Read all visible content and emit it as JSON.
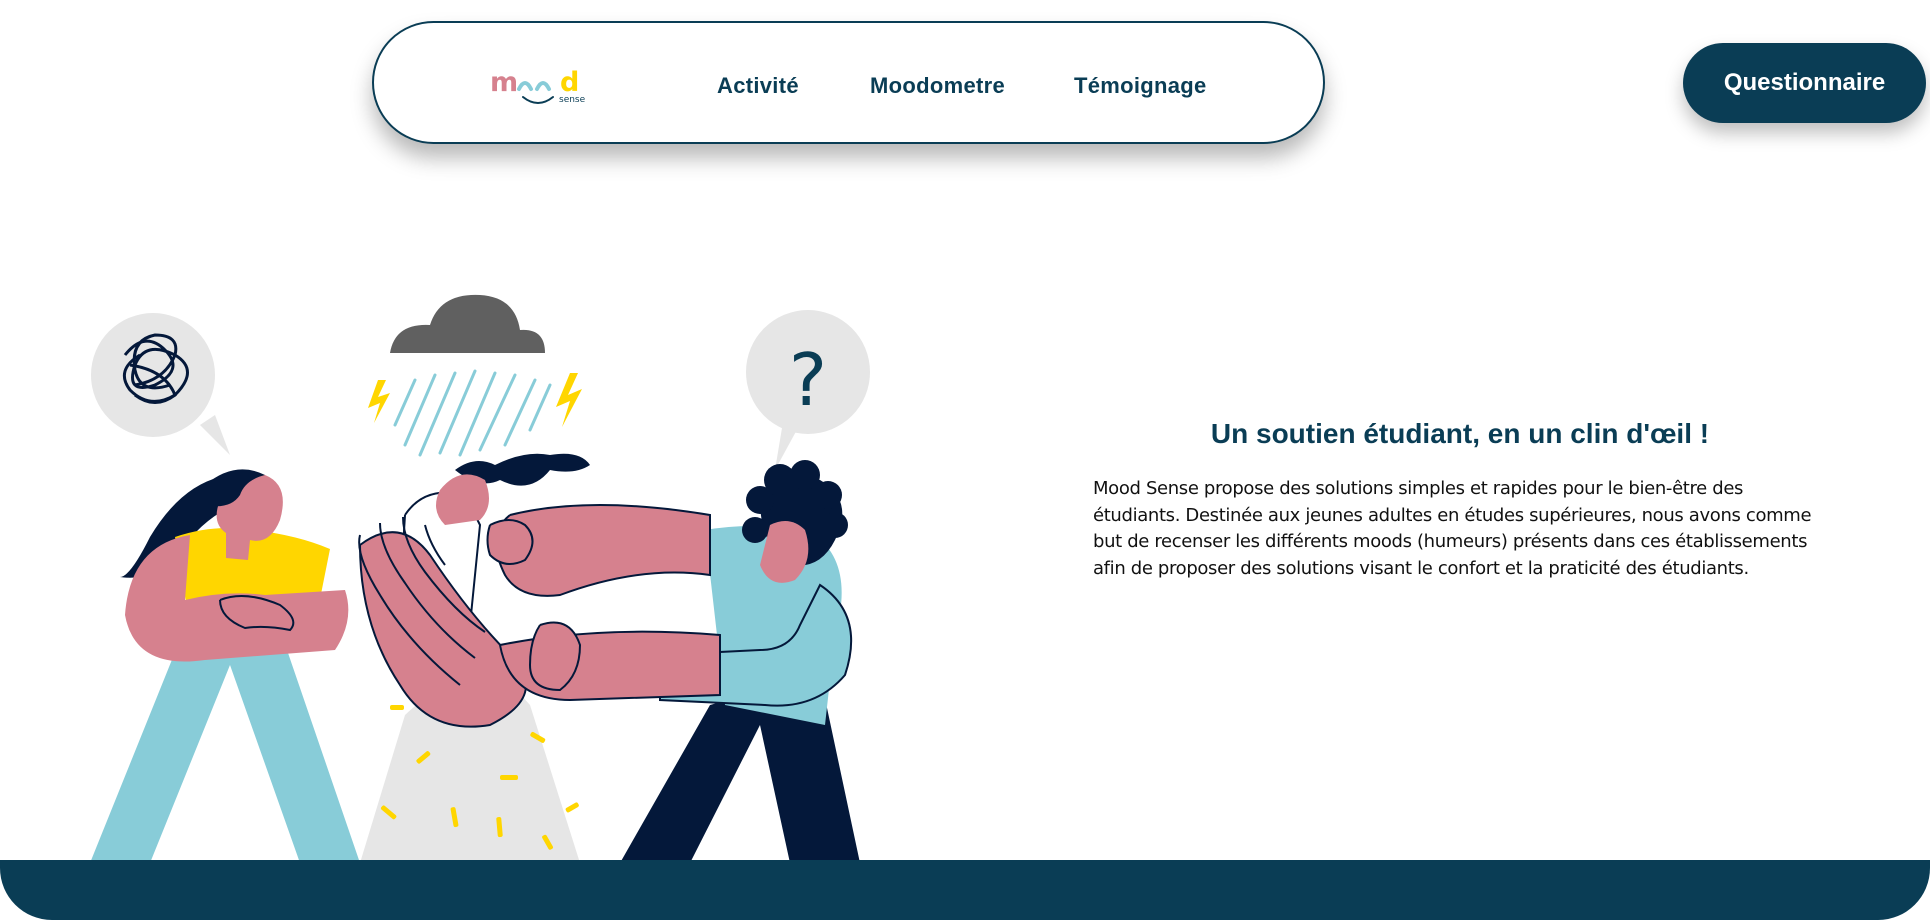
{
  "colors": {
    "primary": "#0a3d55",
    "pink": "#d6818e",
    "yellow": "#ffd600",
    "light_blue": "#88ccd8",
    "navy": "#04183a",
    "grey": "#e6e6e6"
  },
  "logo": {
    "letters_m": "m",
    "letters_d": "d",
    "tagline": "sense"
  },
  "nav": {
    "items": [
      {
        "label": "Activité"
      },
      {
        "label": "Moodometre"
      },
      {
        "label": "Témoignage"
      }
    ]
  },
  "cta": {
    "label": "Questionnaire"
  },
  "hero": {
    "title": "Un soutien étudiant, en un clin d'œil !",
    "body": "Mood Sense propose des solutions simples et rapides pour le bien-être des étudiants. Destinée aux jeunes adultes en études supérieures, nous avons comme but de recenser les différents moods (humeurs) présents dans ces établissements afin de proposer des solutions visant le confort et la praticité des étudiants."
  },
  "illustration": {
    "left_bubble_icon": "scribble-icon",
    "right_bubble_icon": "question-mark-icon",
    "right_bubble_text": "?",
    "cloud_icon": "rain-cloud-icon"
  }
}
